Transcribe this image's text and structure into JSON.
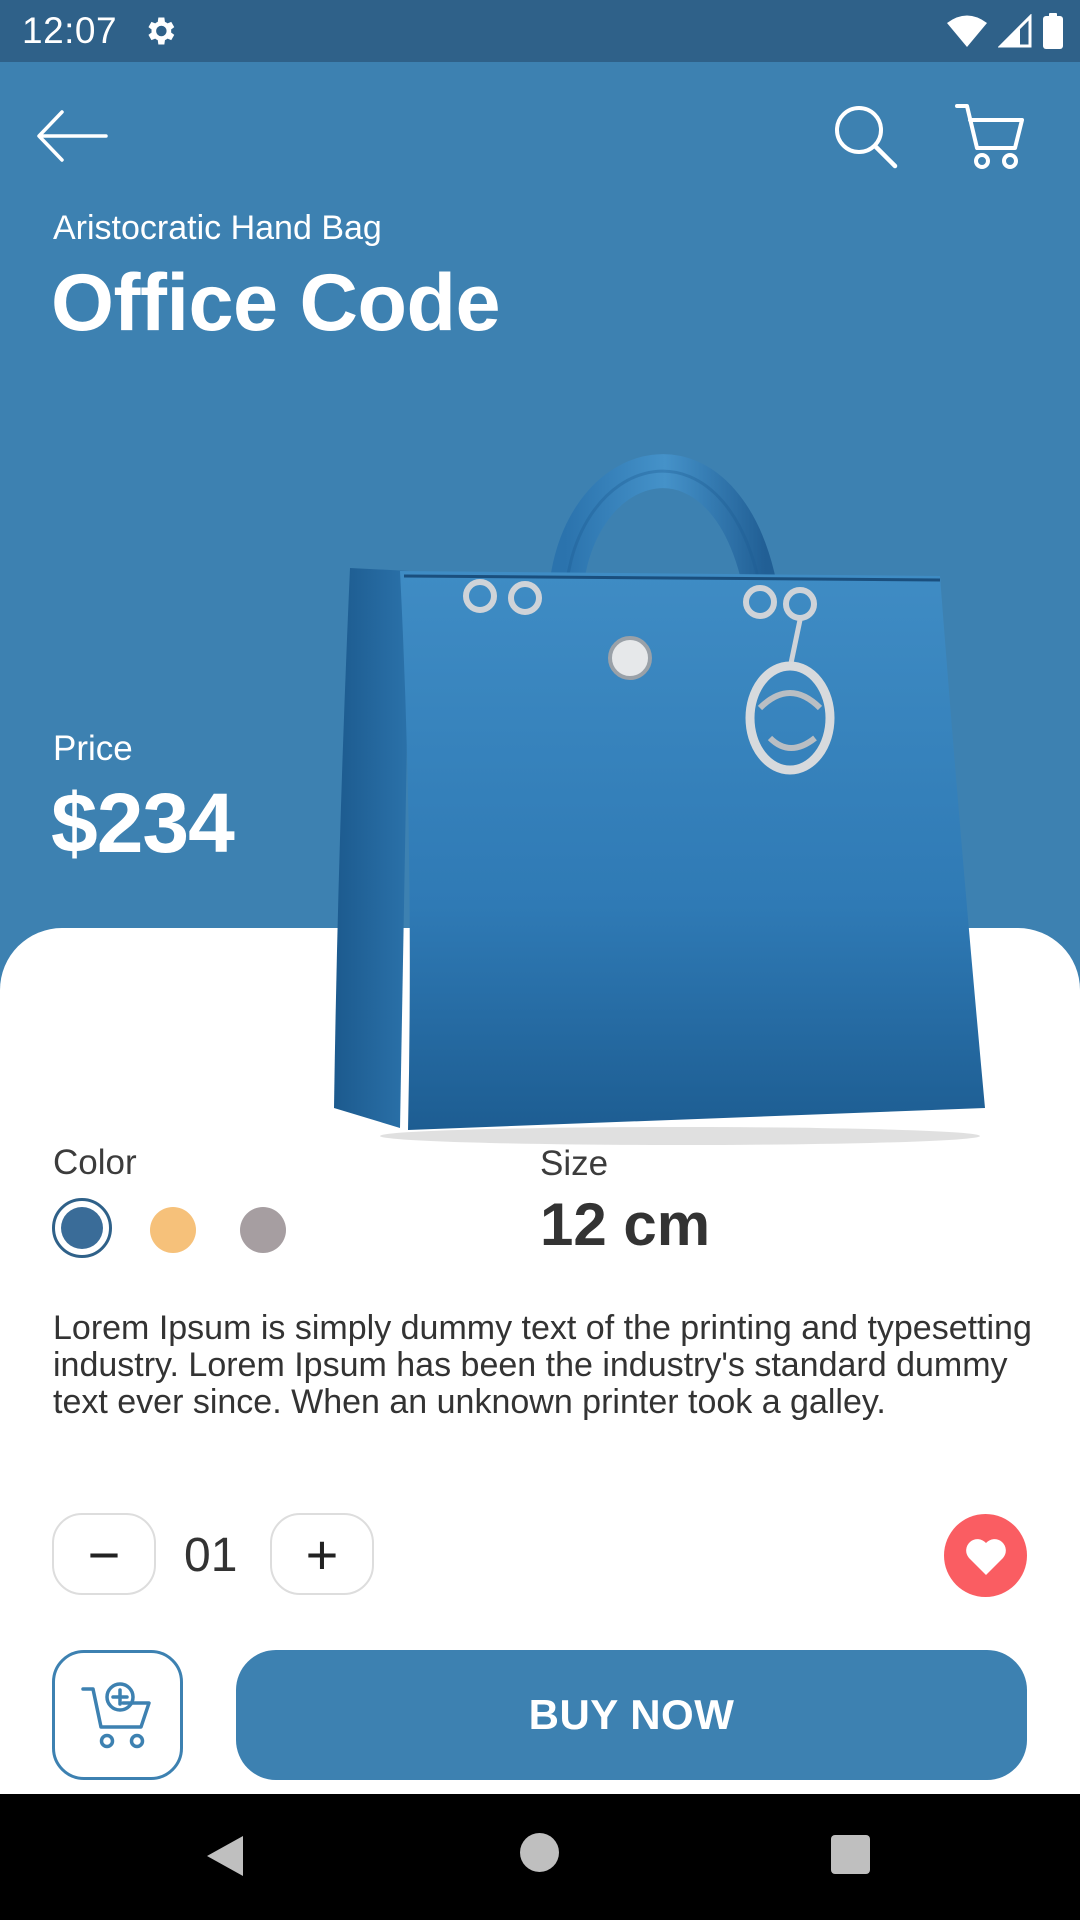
{
  "status_bar": {
    "time": "12:07"
  },
  "product": {
    "subtitle": "Aristocratic Hand Bag",
    "title": "Office Code",
    "price_label": "Price",
    "price": "$234"
  },
  "options": {
    "color_label": "Color",
    "colors": [
      "#3a6c98",
      "#f6c17a",
      "#a69ea1"
    ],
    "selected_color": "#3a6c98",
    "size_label": "Size",
    "size_value": "12 cm"
  },
  "description": "Lorem Ipsum is simply dummy text of the printing and typesetting industry. Lorem Ipsum has been the industry's standard dummy text ever since. When an unknown printer took a galley.",
  "quantity": {
    "minus_label": "−",
    "value": "01",
    "plus_label": "+"
  },
  "actions": {
    "buy_label": "BUY NOW"
  },
  "theme": {
    "primary": "#3d81b1",
    "status_bar": "#2f6189",
    "favorite": "#fa5d62"
  },
  "icons": {
    "back": "arrow-left-icon",
    "search": "search-icon",
    "cart": "cart-icon",
    "favorite": "heart-icon",
    "add_to_cart": "cart-plus-icon"
  }
}
